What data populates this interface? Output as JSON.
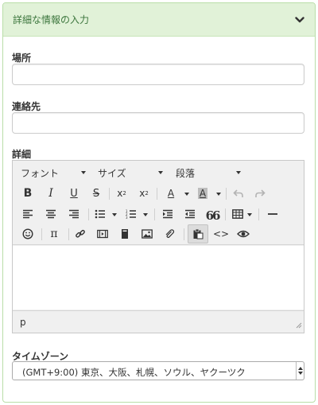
{
  "panel": {
    "title": "詳細な情報の入力"
  },
  "fields": {
    "location_label": "場所",
    "location_value": "",
    "contact_label": "連絡先",
    "contact_value": "",
    "details_label": "詳細",
    "timezone_label": "タイムゾーン",
    "timezone_value": "(GMT+9:00) 東京、大阪、札幌、ソウル、ヤクーツク"
  },
  "editor": {
    "font_dropdown": "フォント",
    "size_dropdown": "サイズ",
    "format_dropdown": "段落",
    "bold": "B",
    "italic": "I",
    "underline": "U",
    "strike": "S",
    "subscript": "x",
    "subscript_mark": "2",
    "superscript": "x",
    "superscript_mark": "2",
    "text_color": "A",
    "bg_color": "A",
    "pi": "π",
    "quote": "66",
    "code": "<>",
    "path": "p"
  },
  "colors": {
    "header_bg": "#e1f2d8",
    "header_text": "#3c763d",
    "panel_border": "#b9dea8"
  },
  "icons": [
    "chevron-down-icon",
    "bold-icon",
    "italic-icon",
    "underline-icon",
    "strikethrough-icon",
    "subscript-icon",
    "superscript-icon",
    "text-color-icon",
    "background-color-icon",
    "undo-icon",
    "redo-icon",
    "align-left-icon",
    "align-center-icon",
    "align-right-icon",
    "bullet-list-icon",
    "numbered-list-icon",
    "indent-icon",
    "outdent-icon",
    "blockquote-icon",
    "table-icon",
    "horizontal-rule-icon",
    "emoticon-icon",
    "pi-icon",
    "link-icon",
    "media-icon",
    "template-icon",
    "image-icon",
    "attachment-icon",
    "paste-icon",
    "code-icon",
    "preview-icon",
    "resize-handle-icon"
  ]
}
